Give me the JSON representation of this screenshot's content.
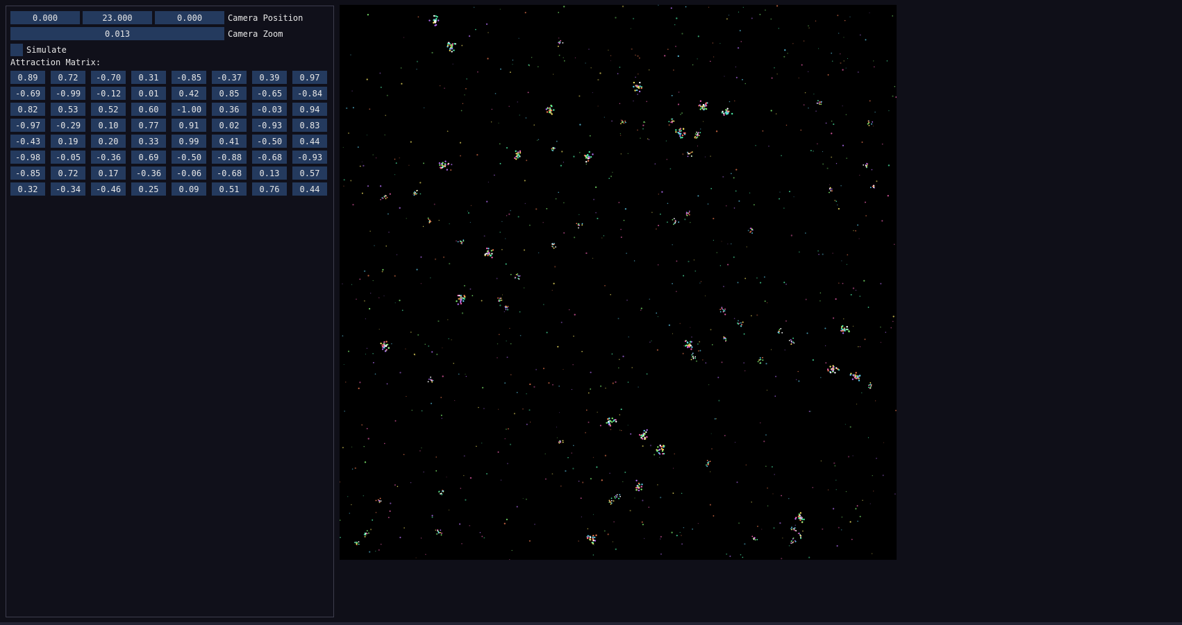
{
  "camera": {
    "position": [
      "0.000",
      "23.000",
      "0.000"
    ],
    "position_label": "Camera Position",
    "zoom": "0.013",
    "zoom_label": "Camera Zoom"
  },
  "simulate": {
    "label": "Simulate",
    "checked": false
  },
  "attraction_matrix": {
    "label": "Attraction Matrix:",
    "rows": [
      [
        "0.89",
        "0.72",
        "-0.70",
        "0.31",
        "-0.85",
        "-0.37",
        "0.39",
        "0.97"
      ],
      [
        "-0.69",
        "-0.99",
        "-0.12",
        "0.01",
        "0.42",
        "0.85",
        "-0.65",
        "-0.84"
      ],
      [
        "0.82",
        "0.53",
        "0.52",
        "0.60",
        "-1.00",
        "0.36",
        "-0.03",
        "0.94"
      ],
      [
        "-0.97",
        "-0.29",
        "0.10",
        "0.77",
        "0.91",
        "0.02",
        "-0.93",
        "0.83"
      ],
      [
        "-0.43",
        "0.19",
        "0.20",
        "0.33",
        "0.99",
        "0.41",
        "-0.50",
        "0.44"
      ],
      [
        "-0.98",
        "-0.05",
        "-0.36",
        "0.69",
        "-0.50",
        "-0.88",
        "-0.68",
        "-0.93"
      ],
      [
        "-0.85",
        "0.72",
        "0.17",
        "-0.36",
        "-0.06",
        "-0.68",
        "0.13",
        "0.57"
      ],
      [
        "0.32",
        "-0.34",
        "-0.46",
        "0.25",
        "0.09",
        "0.51",
        "0.76",
        "0.44"
      ]
    ]
  },
  "particle_colors": [
    "#4ef0a8",
    "#b06cf0",
    "#f07a50",
    "#f0e060",
    "#60d0f0",
    "#f060b0",
    "#80f070",
    "#ffffff"
  ]
}
